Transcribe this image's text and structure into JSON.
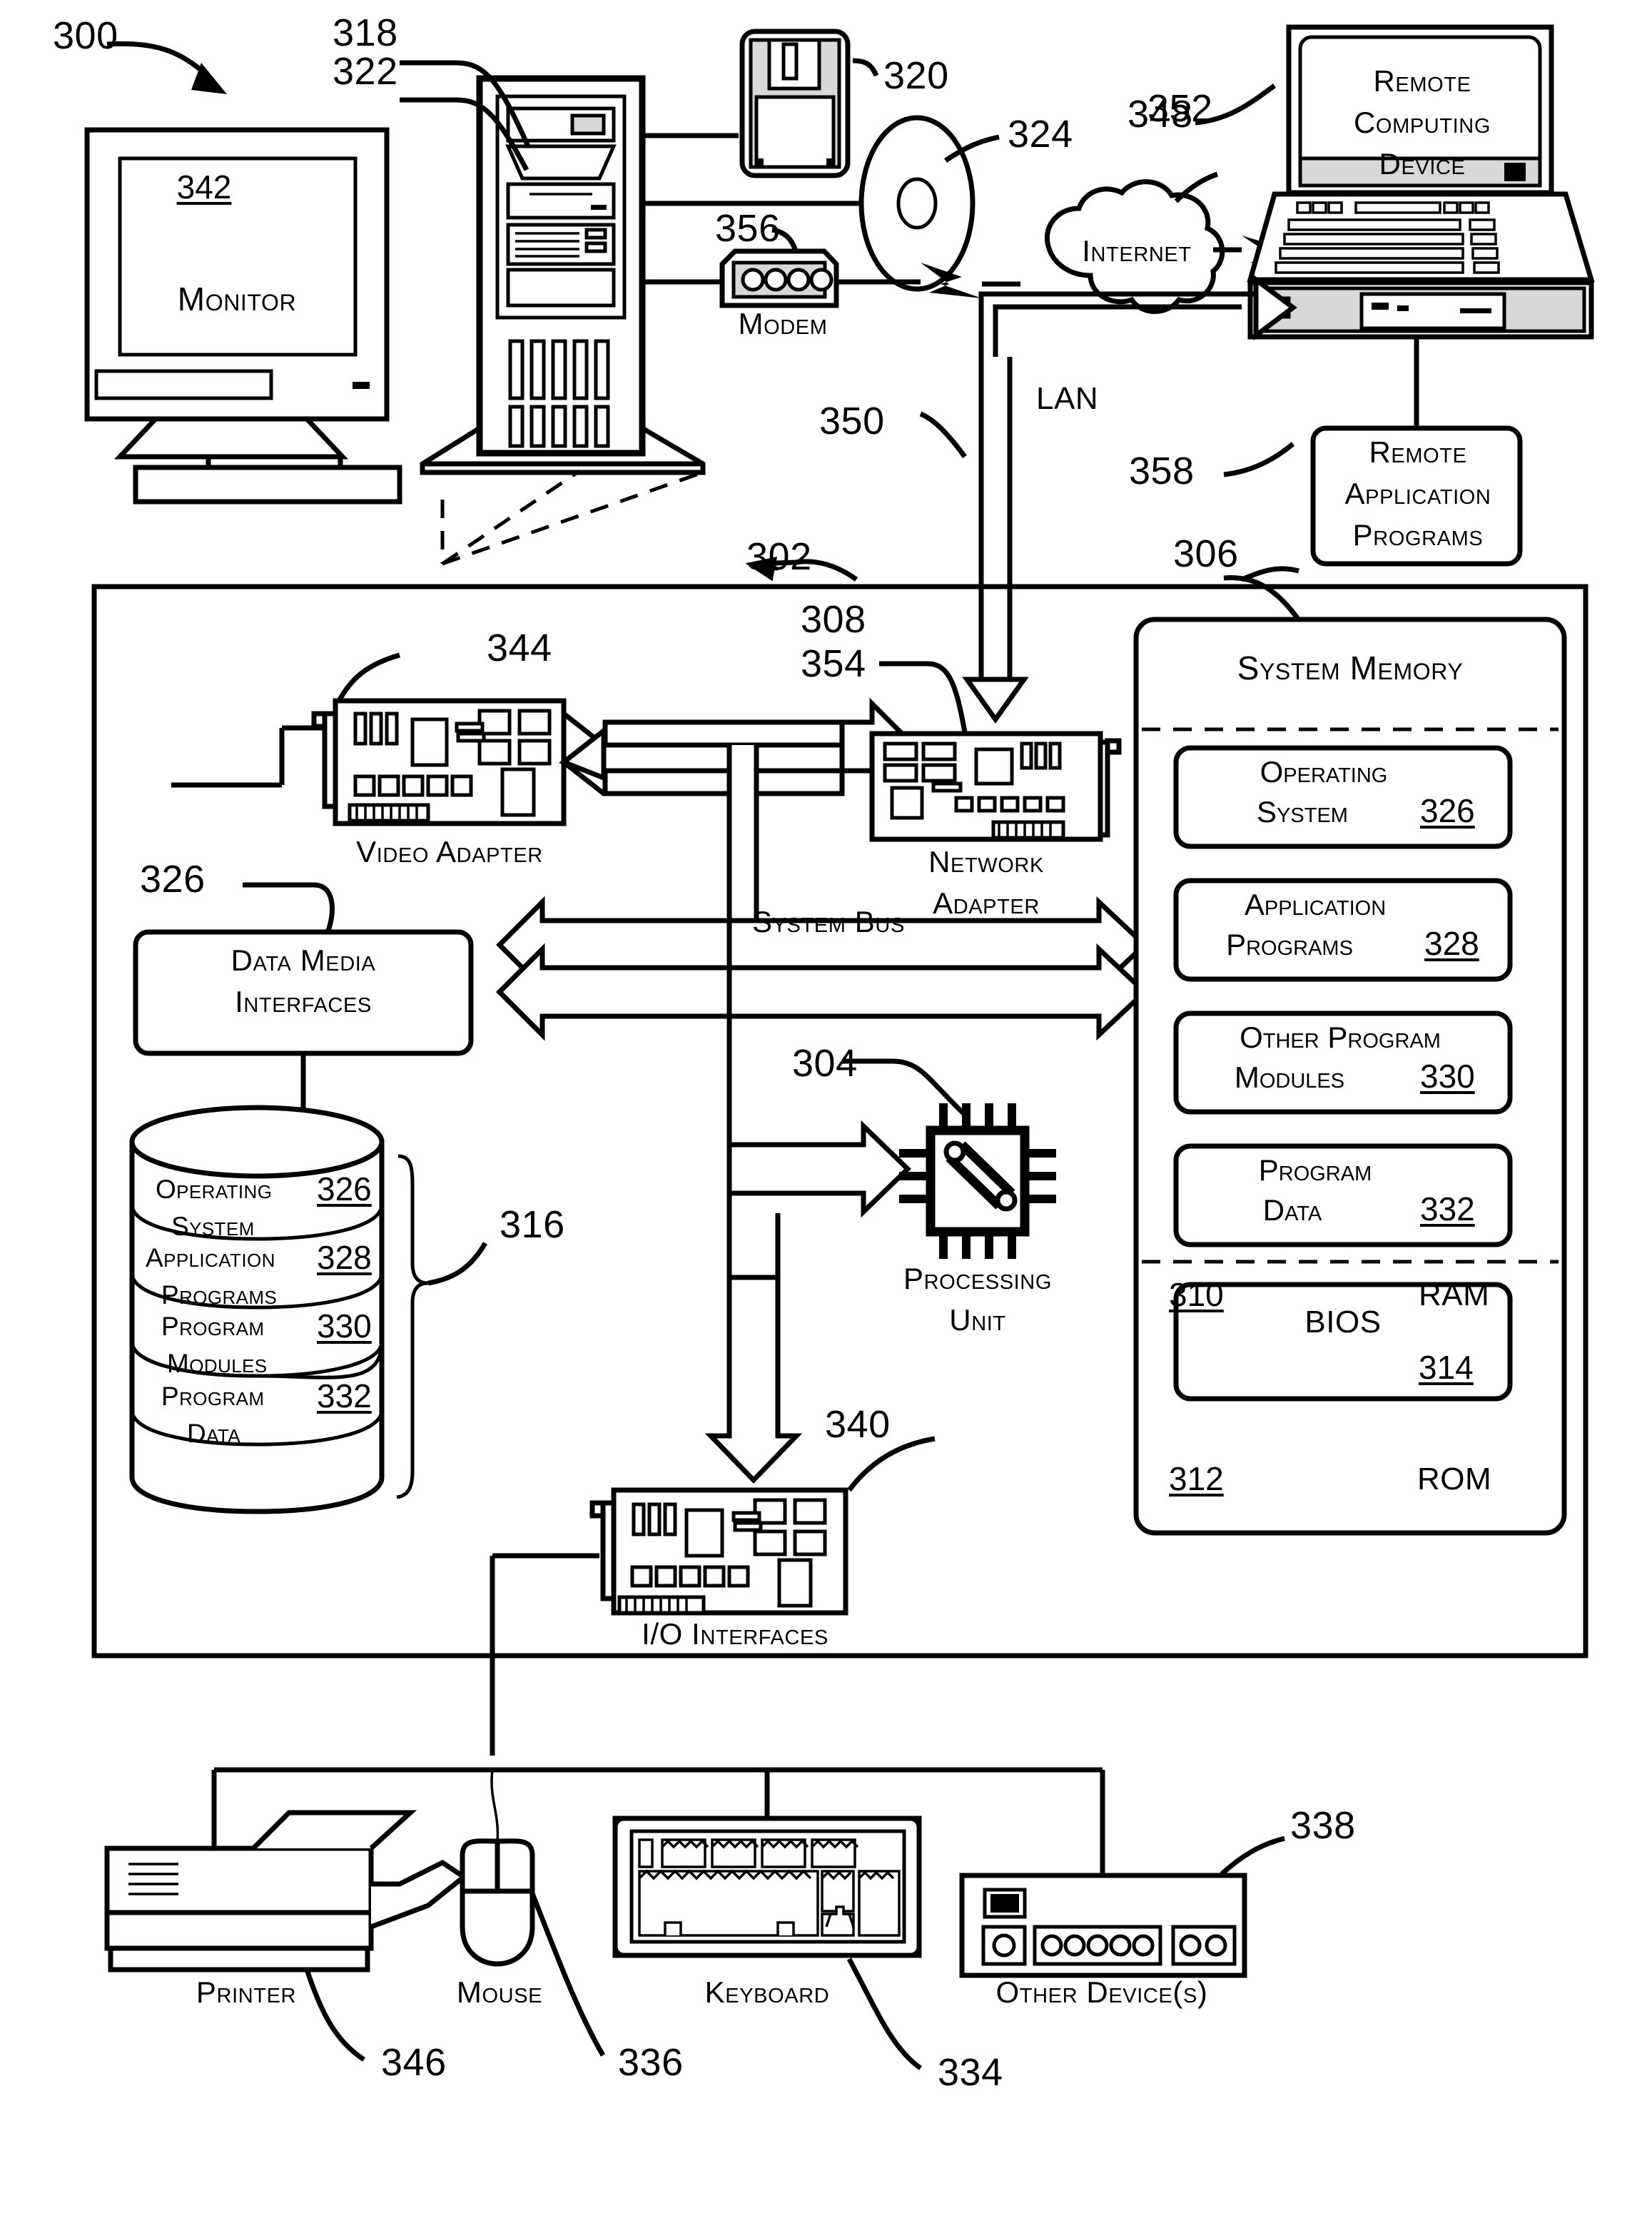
{
  "figure": {
    "id": "300",
    "kind": "patent-block-diagram",
    "background": "#ffffff",
    "ink": "#000000"
  },
  "reference_numerals": {
    "system": "300",
    "outer_boundary": "302",
    "processing_unit": "304",
    "system_memory": "306",
    "system_bus": "308",
    "ram": "310",
    "rom": "312",
    "bios": "314",
    "data_media_brace": "316",
    "computer_tower": "318",
    "floppy_disk": "320",
    "tower_front": "322",
    "optical_disc": "324",
    "operating_system": "326",
    "data_media_interfaces": "326",
    "application_programs": "328",
    "program_modules": "330",
    "program_data": "332",
    "keyboard": "334",
    "mouse": "336",
    "other_devices": "338",
    "io_interfaces": "340",
    "monitor": "342",
    "video_adapter": "344",
    "printer": "346",
    "remote_computing_device": "348",
    "lan": "350",
    "internet": "352",
    "network_adapter": "354",
    "modem": "356",
    "remote_application_programs": "358"
  },
  "top_row": {
    "monitor_label": "Monitor",
    "monitor_ref": "342",
    "tower_ref_upper": "318",
    "tower_ref_lower": "322",
    "floppy_ref": "320",
    "optical_ref": "324",
    "modem_label": "Modem",
    "modem_ref": "356",
    "internet_label": "Internet",
    "internet_ref": "352",
    "remote_device_lines": [
      "Remote",
      "Computing",
      "Device"
    ],
    "remote_device_ref": "348",
    "remote_apps_lines": [
      "Remote",
      "Application",
      "Programs"
    ],
    "remote_apps_ref": "358",
    "lan_label": "LAN",
    "lan_ref": "350",
    "system_ref": "300"
  },
  "chassis": {
    "boundary_ref": "302",
    "system_bus_label": "System Bus",
    "system_bus_ref": "308",
    "video_adapter_label": "Video Adapter",
    "video_adapter_ref": "344",
    "network_adapter_lines": [
      "Network",
      "Adapter"
    ],
    "network_adapter_ref": "354",
    "data_media_lines": [
      "Data Media",
      "Interfaces"
    ],
    "data_media_ref": "326",
    "processing_unit_lines": [
      "Processing",
      "Unit"
    ],
    "processing_unit_ref": "304",
    "io_interfaces_label": "I/O Interfaces",
    "io_interfaces_ref": "340",
    "brace_ref": "316"
  },
  "disk_stack": {
    "items": [
      {
        "line1": "Operating",
        "line2": "System",
        "ref": "326"
      },
      {
        "line1": "Application",
        "line2": "Programs",
        "ref": "328"
      },
      {
        "line1": "Program",
        "line2": "Modules",
        "ref": "330"
      },
      {
        "line1": "Program",
        "line2": "Data",
        "ref": "332"
      }
    ]
  },
  "system_memory": {
    "title": "System Memory",
    "ref": "306",
    "ram_label": "RAM",
    "ram_ref": "310",
    "rom_label": "ROM",
    "rom_ref": "312",
    "ram_blocks": [
      {
        "line1": "Operating",
        "line2": "System",
        "ref": "326"
      },
      {
        "line1": "Application",
        "line2": "Programs",
        "ref": "328"
      },
      {
        "line1": "Other Program",
        "line2": "Modules",
        "ref": "330"
      },
      {
        "line1": "Program",
        "line2": "Data",
        "ref": "332"
      }
    ],
    "rom_blocks": [
      {
        "line1": "BIOS",
        "line2": "",
        "ref": "314"
      }
    ]
  },
  "peripherals": [
    {
      "label": "Printer",
      "ref": "346",
      "icon": "printer-icon"
    },
    {
      "label": "Mouse",
      "ref": "336",
      "icon": "mouse-icon"
    },
    {
      "label": "Keyboard",
      "ref": "334",
      "icon": "keyboard-icon"
    },
    {
      "label": "Other Device(s)",
      "ref": "338",
      "icon": "other-devices-icon"
    }
  ]
}
